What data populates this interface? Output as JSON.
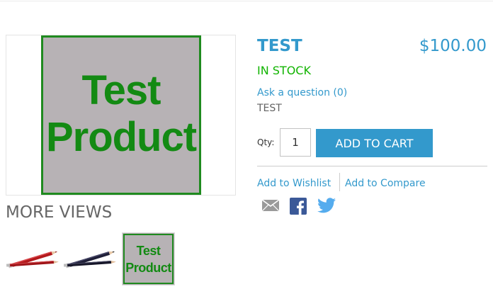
{
  "gallery": {
    "main_image_line1": "Test",
    "main_image_line2": "Product",
    "more_views_label": "MORE VIEWS",
    "thumb_text_line1": "Test",
    "thumb_text_line2": "Product"
  },
  "product": {
    "name": "TEST",
    "price": "$100.00",
    "stock_status": "IN STOCK",
    "ask_question": "Ask a question (0)",
    "description": "TEST"
  },
  "cart": {
    "qty_label": "Qty:",
    "qty_value": "1",
    "add_to_cart_label": "ADD TO CART"
  },
  "links": {
    "wishlist": "Add to Wishlist",
    "compare": "Add to Compare"
  },
  "colors": {
    "accent": "#3399cc",
    "stock": "#11b400",
    "product_green": "#138a13",
    "product_bg": "#b7b2b5"
  },
  "icons": {
    "share_email": "email-icon",
    "share_facebook": "facebook-icon",
    "share_twitter": "twitter-icon"
  }
}
